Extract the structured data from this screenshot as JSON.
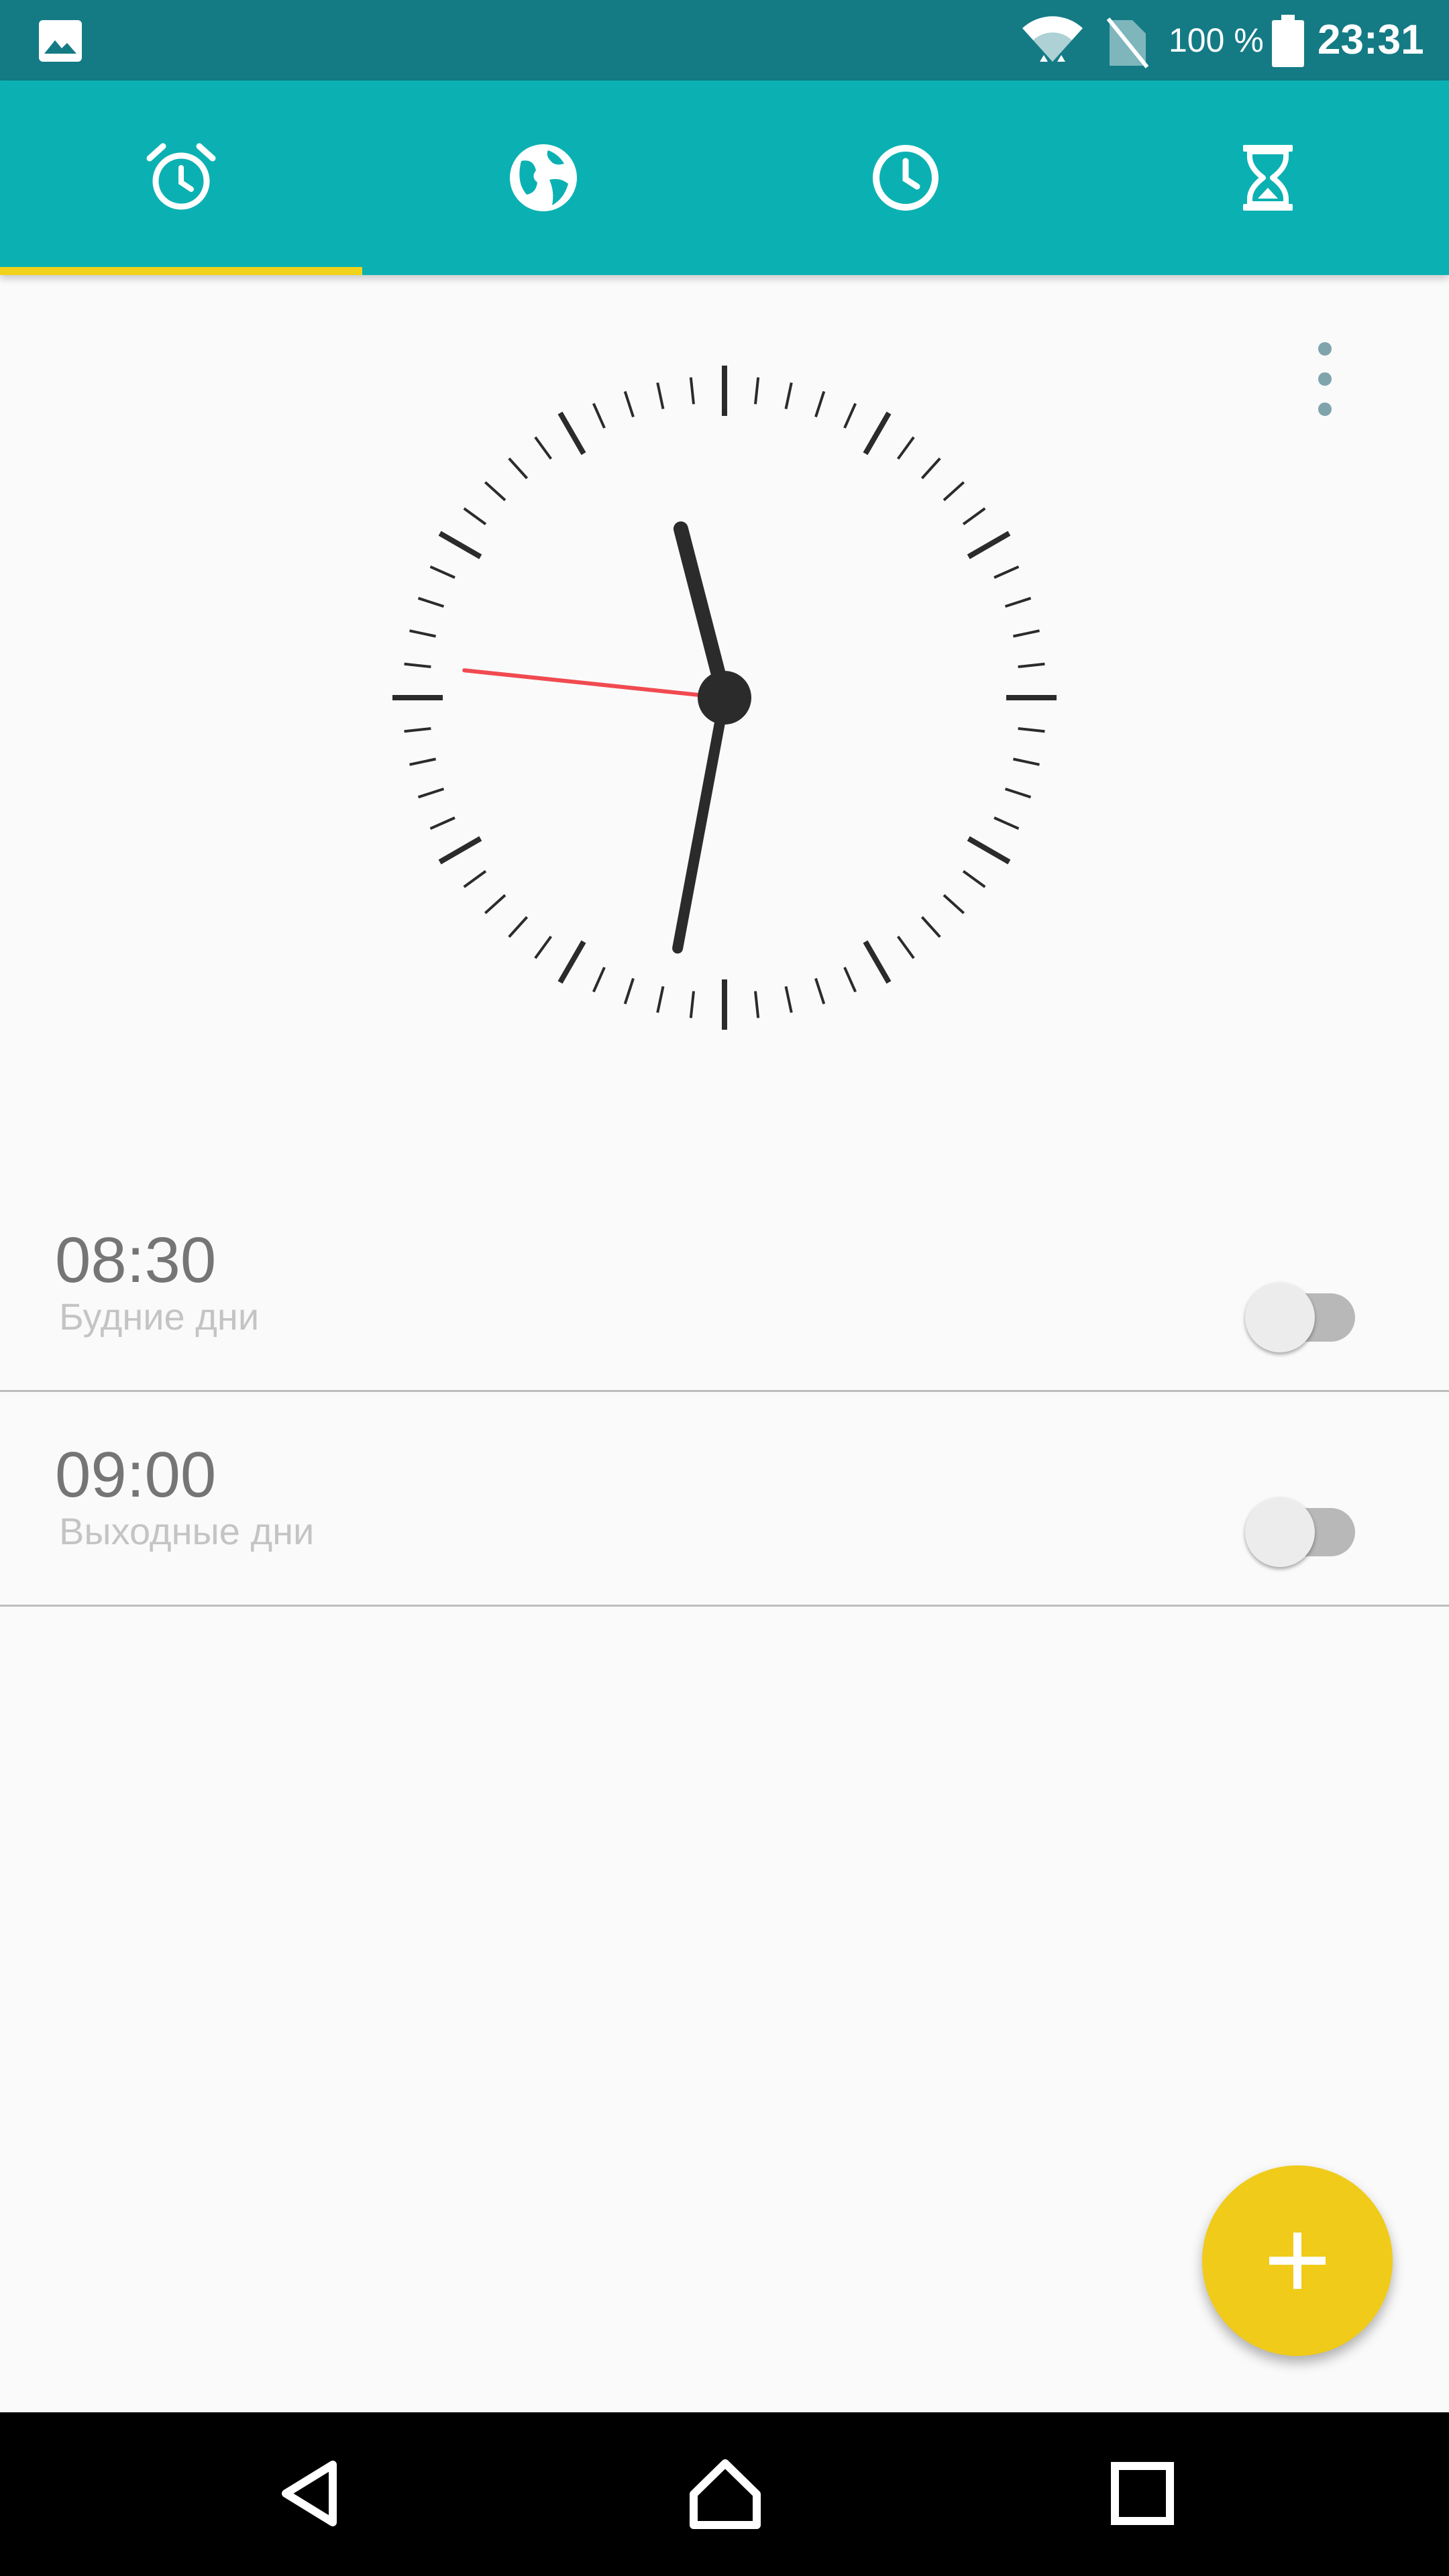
{
  "status_bar": {
    "battery_text": "100 %",
    "time": "23:31",
    "icons": [
      "image-icon",
      "wifi-icon",
      "no-sim-icon",
      "battery-icon"
    ]
  },
  "tabs": [
    {
      "name": "alarm",
      "icon": "alarm-clock-icon",
      "selected": true
    },
    {
      "name": "world-clock",
      "icon": "globe-icon",
      "selected": false
    },
    {
      "name": "clock",
      "icon": "clock-icon",
      "selected": false
    },
    {
      "name": "timer",
      "icon": "hourglass-icon",
      "selected": false
    }
  ],
  "analog_clock": {
    "hours": 23,
    "minutes": 31,
    "seconds": 46
  },
  "alarms": [
    {
      "time": "08:30",
      "days": "Будние дни",
      "enabled": false
    },
    {
      "time": "09:00",
      "days": "Выходные дни",
      "enabled": false
    }
  ],
  "fab": {
    "icon": "plus-icon"
  },
  "nav_bar": {
    "icons": [
      "back-icon",
      "home-icon",
      "recents-icon"
    ]
  },
  "colors": {
    "status_bar": "#147b85",
    "tab_bar": "#0bb1b2",
    "tab_indicator": "#f0d21a",
    "fab": "#f0cb19",
    "second_hand": "#f04a50"
  }
}
